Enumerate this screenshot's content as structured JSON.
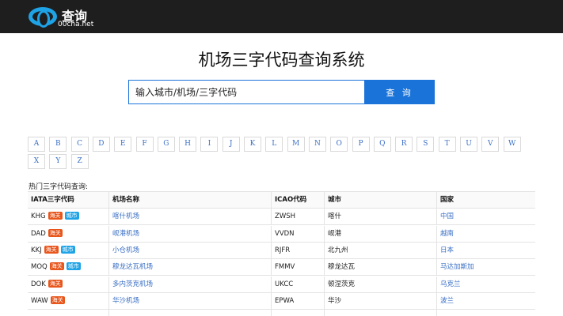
{
  "header": {
    "logo_title": "查询",
    "logo_sub": "00cha.net"
  },
  "hero": {
    "title": "机场三字代码查询系统"
  },
  "search": {
    "placeholder": "输入城市/机场/三字代码",
    "button": "查 询"
  },
  "letters": [
    "A",
    "B",
    "C",
    "D",
    "E",
    "F",
    "G",
    "H",
    "I",
    "J",
    "K",
    "L",
    "M",
    "N",
    "O",
    "P",
    "Q",
    "R",
    "S",
    "T",
    "U",
    "V",
    "W",
    "X",
    "Y",
    "Z"
  ],
  "hot": {
    "label": "热门三字代码查询:"
  },
  "table": {
    "headers": [
      "IATA三字代码",
      "机场名称",
      "ICAO代码",
      "城市",
      "国家"
    ],
    "badge_customs": "海关",
    "badge_city": "城市",
    "rows": [
      {
        "iata": "KHG",
        "customs": true,
        "city": true,
        "name": "喀什机场",
        "icao": "ZWSH",
        "cityname": "喀什",
        "country": "中国"
      },
      {
        "iata": "DAD",
        "customs": true,
        "city": false,
        "name": "岘港机场",
        "icao": "VVDN",
        "cityname": "岘港",
        "country": "越南"
      },
      {
        "iata": "KKJ",
        "customs": true,
        "city": true,
        "name": "小仓机场",
        "icao": "RJFR",
        "cityname": "北九州",
        "country": "日本"
      },
      {
        "iata": "MOQ",
        "customs": true,
        "city": true,
        "name": "穆龙达瓦机场",
        "icao": "FMMV",
        "cityname": "穆龙达瓦",
        "country": "马达加斯加"
      },
      {
        "iata": "DOK",
        "customs": true,
        "city": false,
        "name": "多内茨克机场",
        "icao": "UKCC",
        "cityname": "顿涅茨克",
        "country": "乌克兰"
      },
      {
        "iata": "WAW",
        "customs": true,
        "city": false,
        "name": "华沙机场",
        "icao": "EPWA",
        "cityname": "华沙",
        "country": "波兰"
      }
    ]
  }
}
